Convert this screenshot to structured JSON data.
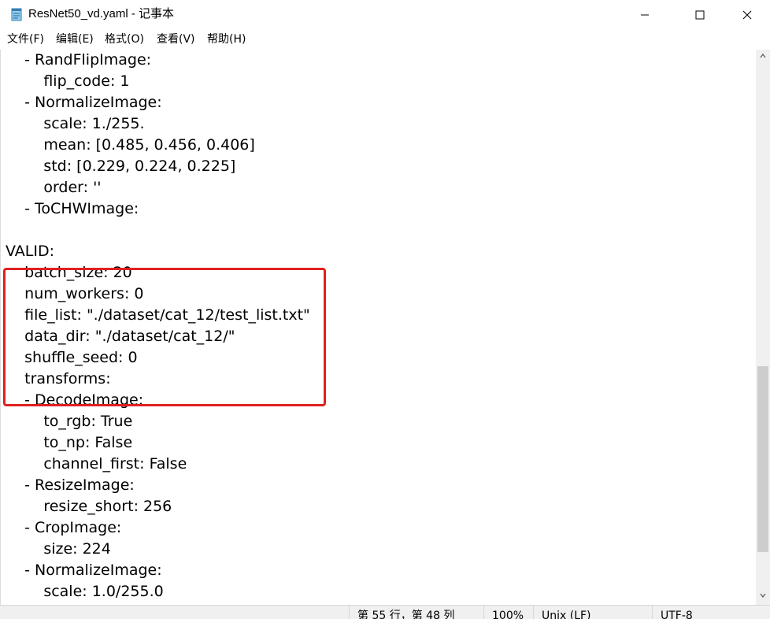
{
  "window": {
    "title": "ResNet50_vd.yaml - 记事本",
    "icon": "notepad-icon",
    "controls": [
      "minimize-icon",
      "maximize-icon",
      "close-icon"
    ]
  },
  "menu": [
    "文件(F)",
    "编辑(E)",
    "格式(O)",
    "查看(V)",
    "帮助(H)"
  ],
  "editor": {
    "lines": [
      "    - RandFlipImage:",
      "        flip_code: 1",
      "    - NormalizeImage:",
      "        scale: 1./255.",
      "        mean: [0.485, 0.456, 0.406]",
      "        std: [0.229, 0.224, 0.225]",
      "        order: ''",
      "    - ToCHWImage:",
      "",
      "VALID:",
      "    batch_size: 20",
      "    num_workers: 0",
      "    file_list: \"./dataset/cat_12/test_list.txt\"",
      "    data_dir: \"./dataset/cat_12/\"",
      "    shuffle_seed: 0",
      "    transforms:",
      "    - DecodeImage:",
      "        to_rgb: True",
      "        to_np: False",
      "        channel_first: False",
      "    - ResizeImage:",
      "        resize_short: 256",
      "    - CropImage:",
      "        size: 224",
      "    - NormalizeImage:",
      "        scale: 1.0/255.0"
    ],
    "highlight_color": "#e02020"
  },
  "status": {
    "position": "第 55 行，第 48 列",
    "zoom": "100%",
    "line_ending": "Unix (LF)",
    "encoding": "UTF-8"
  }
}
